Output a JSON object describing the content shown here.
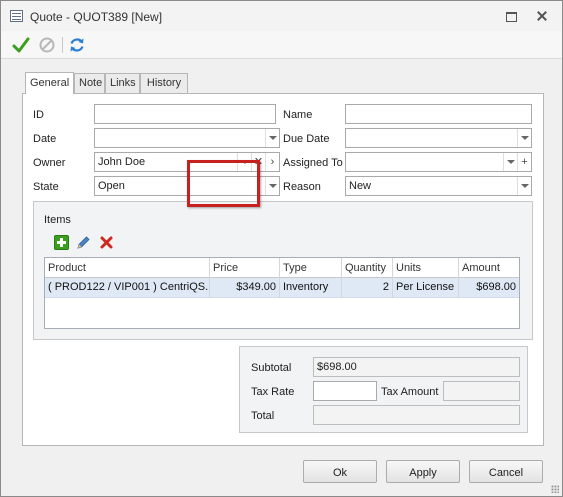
{
  "window": {
    "title": "Quote - QUOT389 [New]"
  },
  "tabs": [
    {
      "label": "General",
      "active": true
    },
    {
      "label": "Note",
      "active": false
    },
    {
      "label": "Links",
      "active": false
    },
    {
      "label": "History",
      "active": false
    }
  ],
  "form": {
    "id": {
      "label": "ID",
      "value": ""
    },
    "name": {
      "label": "Name",
      "value": ""
    },
    "date": {
      "label": "Date",
      "value": ""
    },
    "due_date": {
      "label": "Due Date",
      "value": ""
    },
    "owner": {
      "label": "Owner",
      "value": "John Doe"
    },
    "assigned_to": {
      "label": "Assigned To",
      "value": ""
    },
    "state": {
      "label": "State",
      "value": "Open"
    },
    "reason": {
      "label": "Reason",
      "value": "New"
    }
  },
  "items": {
    "title": "Items",
    "columns": [
      "Product",
      "Price",
      "Type",
      "Quantity",
      "Units",
      "Amount"
    ],
    "rows": [
      {
        "product": "( PROD122 / VIP001 ) CentriQS...",
        "price": "$349.00",
        "type": "Inventory",
        "quantity": "2",
        "units": "Per License",
        "amount": "$698.00"
      }
    ]
  },
  "totals": {
    "subtotal_label": "Subtotal",
    "subtotal_value": "$698.00",
    "tax_rate_label": "Tax Rate",
    "tax_rate_value": "",
    "tax_amount_label": "Tax Amount",
    "tax_amount_value": "",
    "total_label": "Total",
    "total_value": ""
  },
  "buttons": {
    "ok": "Ok",
    "apply": "Apply",
    "cancel": "Cancel"
  },
  "icons": {
    "save": "checkmark-icon",
    "cancel": "cancel-circle-icon",
    "refresh": "refresh-icon",
    "add": "add-icon",
    "edit": "pencil-icon",
    "delete": "delete-x-icon"
  },
  "colors": {
    "highlight": "#c8201f",
    "selected_row": "#dfe8f5",
    "save_green": "#3b9e1f",
    "refresh_blue": "#2a7fd4",
    "delete_red": "#d0281c"
  }
}
